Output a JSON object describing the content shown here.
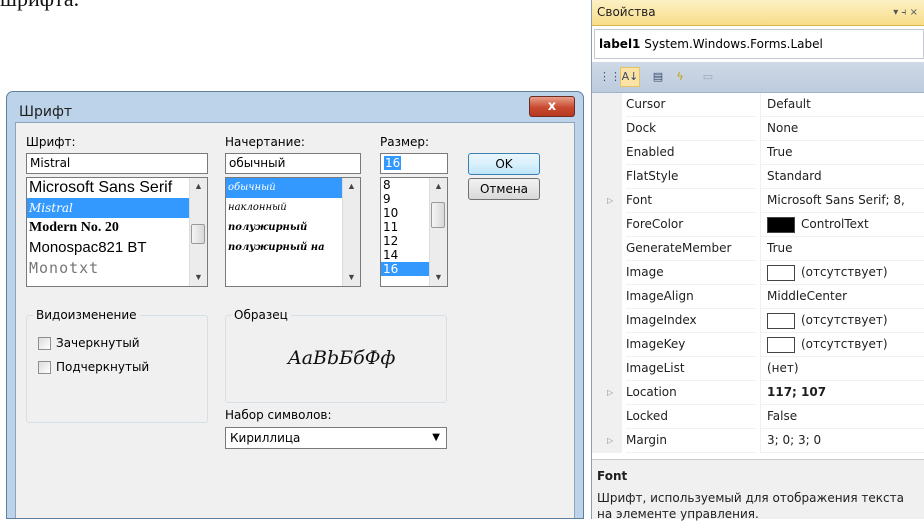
{
  "doc_text": "шрифта.",
  "font_dialog": {
    "title": "Шрифт",
    "close_label": "x",
    "font_label": "Шрифт:",
    "font_value": "Mistral",
    "font_list": [
      "Microsoft Sans Serif",
      "Mistral",
      "Modern No. 20",
      "Monospac821 BT",
      "Monotxt"
    ],
    "font_selected": "Mistral",
    "style_label": "Начертание:",
    "style_value": "обычный",
    "style_list": [
      "обычный",
      "наклонный",
      "полужирный",
      "полужирный на"
    ],
    "style_selected": "обычный",
    "size_label": "Размер:",
    "size_value": "16",
    "size_list": [
      "8",
      "9",
      "10",
      "11",
      "12",
      "14",
      "16"
    ],
    "size_selected": "16",
    "ok_label": "OK",
    "cancel_label": "Отмена",
    "effects_label": "Видоизменение",
    "strikeout_label": "Зачеркнутый",
    "underline_label": "Подчеркнутый",
    "strikeout_checked": false,
    "underline_checked": false,
    "sample_label": "Образец",
    "sample_text": "AaBbБбФф",
    "script_label": "Набор символов:",
    "script_value": "Кириллица"
  },
  "properties": {
    "title": "Свойства",
    "title_tools": "▾ ⫞ ×",
    "object_name": "label1",
    "object_type": "System.Windows.Forms.Label",
    "toolbar_icons": [
      "categorized-icon",
      "alphabetical-icon",
      "properties-icon",
      "events-icon",
      "property-pages-icon"
    ],
    "rows": [
      {
        "name": "Cursor",
        "value": "Default"
      },
      {
        "name": "Dock",
        "value": "None"
      },
      {
        "name": "Enabled",
        "value": "True"
      },
      {
        "name": "FlatStyle",
        "value": "Standard"
      },
      {
        "name": "Font",
        "value": "Microsoft Sans Serif; 8,",
        "expandable": true
      },
      {
        "name": "ForeColor",
        "value": "ControlText",
        "swatch": "#000000"
      },
      {
        "name": "GenerateMember",
        "value": "True"
      },
      {
        "name": "Image",
        "value": "(отсутствует)",
        "swatch": "#ffffff"
      },
      {
        "name": "ImageAlign",
        "value": "MiddleCenter"
      },
      {
        "name": "ImageIndex",
        "value": "(отсутствует)",
        "swatch": "#ffffff"
      },
      {
        "name": "ImageKey",
        "value": "(отсутствует)",
        "swatch": "#ffffff"
      },
      {
        "name": "ImageList",
        "value": "(нет)"
      },
      {
        "name": "Location",
        "value": "117; 107",
        "expandable": true,
        "bold": true
      },
      {
        "name": "Locked",
        "value": "False"
      },
      {
        "name": "Margin",
        "value": "3; 0; 3; 0",
        "expandable": true
      }
    ],
    "description_title": "Font",
    "description_text": "Шрифт, используемый для отображения текста на элементе управления."
  }
}
